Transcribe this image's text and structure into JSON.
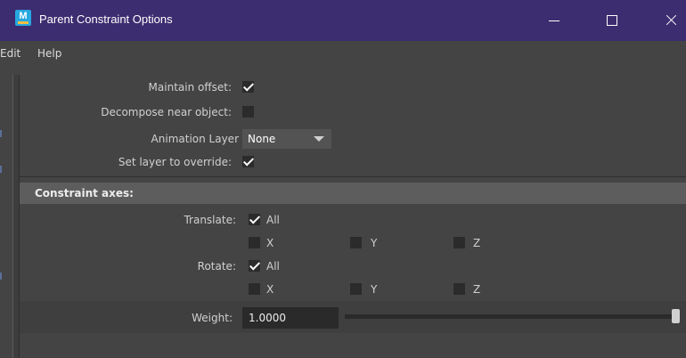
{
  "window": {
    "title": "Parent Constraint Options",
    "icon": "maya-app-icon",
    "controls": [
      "minimize-icon",
      "maximize-icon",
      "close-icon"
    ]
  },
  "menu": {
    "items": [
      "Edit",
      "Help"
    ]
  },
  "options": {
    "maintain_offset": {
      "label": "Maintain offset:",
      "checked": true
    },
    "decompose_near_object": {
      "label": "Decompose near object:",
      "checked": false
    },
    "animation_layer": {
      "label": "Animation Layer",
      "value": "None"
    },
    "set_layer_to_override": {
      "label": "Set layer to override:",
      "checked": true
    }
  },
  "constraint_axes": {
    "title": "Constraint axes:",
    "translate": {
      "label": "Translate:",
      "all": {
        "label": "All",
        "checked": true
      },
      "x": {
        "label": "X",
        "checked": false
      },
      "y": {
        "label": "Y",
        "checked": false
      },
      "z": {
        "label": "Z",
        "checked": false
      }
    },
    "rotate": {
      "label": "Rotate:",
      "all": {
        "label": "All",
        "checked": true
      },
      "x": {
        "label": "X",
        "checked": false
      },
      "y": {
        "label": "Y",
        "checked": false
      },
      "z": {
        "label": "Z",
        "checked": false
      }
    }
  },
  "weight": {
    "label": "Weight:",
    "value": "1.0000",
    "slider_fraction": 1.0
  },
  "colors": {
    "title_bar": "#3c2c70",
    "background": "#444444",
    "section_header": "#5d5d5d",
    "checkbox": "#2b2b2b",
    "field": "#2a2a2a"
  }
}
